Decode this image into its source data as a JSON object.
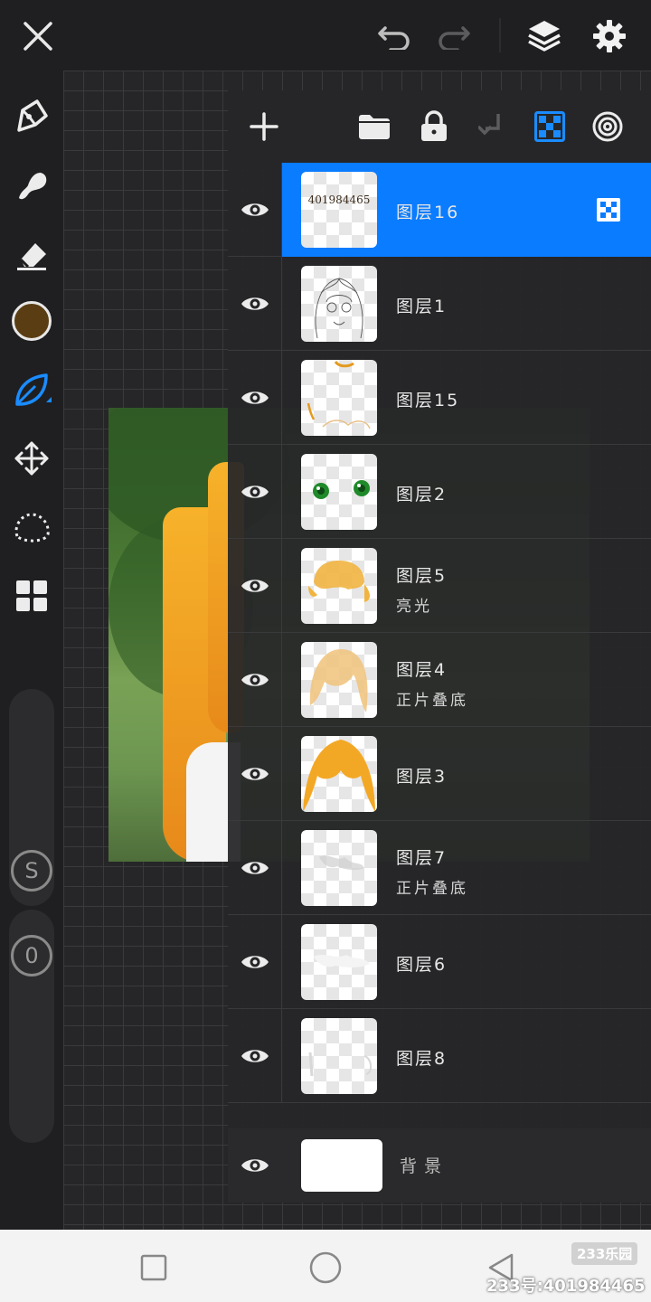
{
  "colors": {
    "accent": "#0a7cff",
    "brush_color": "#5a3d12",
    "panel_bg": "#262628",
    "toolbar_bg": "#1f1f21"
  },
  "topbar": {
    "icons": [
      "close-icon",
      "undo-icon",
      "redo-icon",
      "layers-icon",
      "settings-icon"
    ]
  },
  "toolbar": {
    "tools": [
      "brush-icon",
      "smudge-icon",
      "eraser-icon",
      "color-swatch",
      "leaf-brush-icon",
      "move-icon",
      "lasso-icon",
      "gallery-grid-icon"
    ],
    "size_slider_label": "S",
    "opacity_slider_label": "0"
  },
  "layers_panel": {
    "toolbar_icons": [
      "add-layer-icon",
      "folder-icon",
      "lock-icon",
      "merge-down-icon",
      "alpha-lock-icon",
      "blend-icon"
    ],
    "layers": [
      {
        "name": "图层16",
        "mode": "",
        "thumb_text": "401984465",
        "visible": true,
        "active": true
      },
      {
        "name": "图层1",
        "mode": "",
        "thumb_text": "",
        "visible": true,
        "active": false
      },
      {
        "name": "图层15",
        "mode": "",
        "thumb_text": "",
        "visible": true,
        "active": false
      },
      {
        "name": "图层2",
        "mode": "",
        "thumb_text": "",
        "visible": true,
        "active": false
      },
      {
        "name": "图层5",
        "mode": "亮光",
        "thumb_text": "",
        "visible": true,
        "active": false
      },
      {
        "name": "图层4",
        "mode": "正片叠底",
        "thumb_text": "",
        "visible": true,
        "active": false
      },
      {
        "name": "图层3",
        "mode": "",
        "thumb_text": "",
        "visible": true,
        "active": false
      },
      {
        "name": "图层7",
        "mode": "正片叠底",
        "thumb_text": "",
        "visible": true,
        "active": false
      },
      {
        "name": "图层6",
        "mode": "",
        "thumb_text": "",
        "visible": true,
        "active": false
      },
      {
        "name": "图层8",
        "mode": "",
        "thumb_text": "",
        "visible": true,
        "active": false
      }
    ],
    "background": {
      "name": "背景",
      "visible": true
    }
  },
  "navbar": {
    "icons": [
      "recent-apps-icon",
      "home-icon",
      "back-icon"
    ]
  },
  "watermark": {
    "logo": "233乐园",
    "text": "233号:401984465"
  }
}
